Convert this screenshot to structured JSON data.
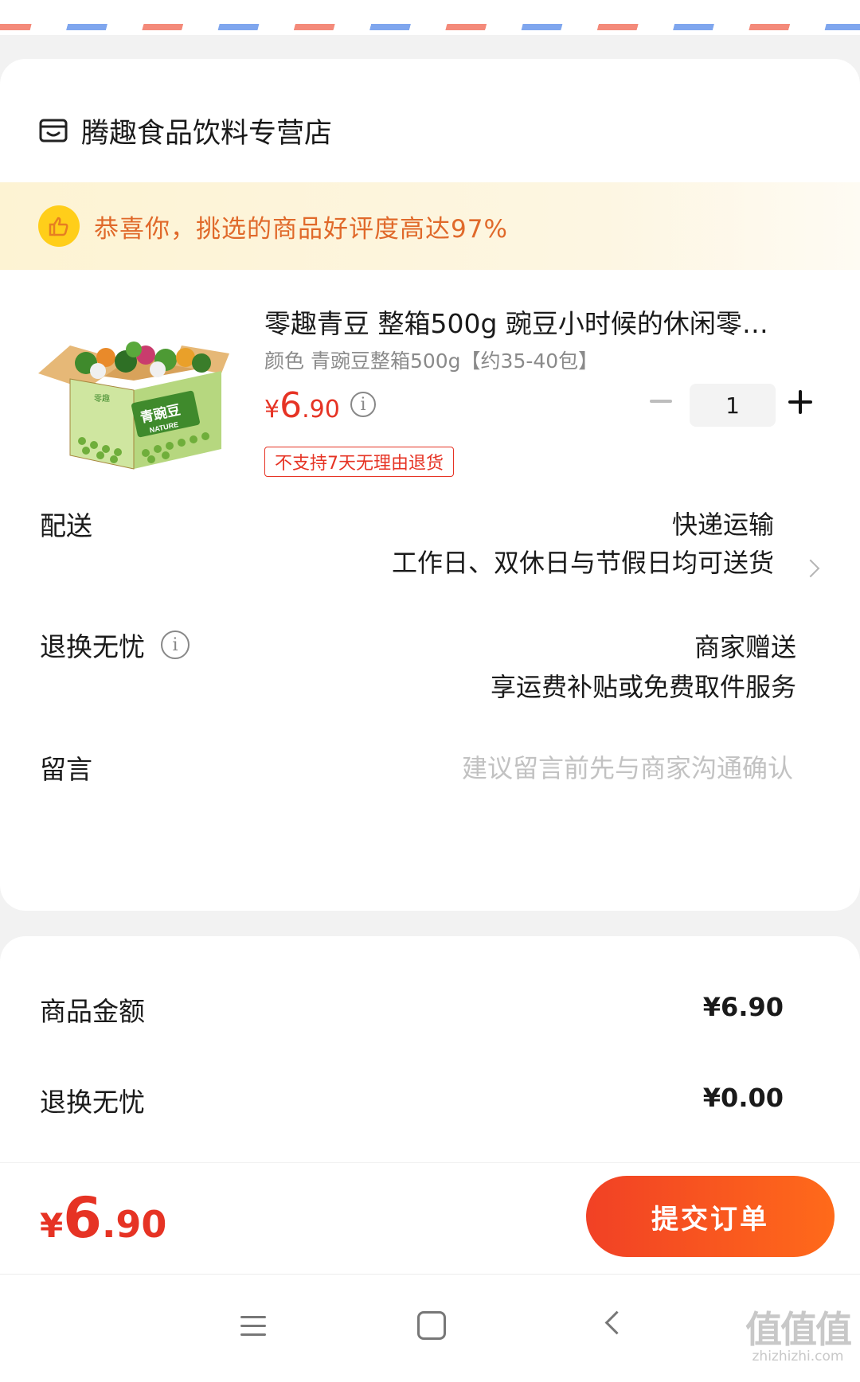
{
  "store": {
    "name": "腾趣食品饮料专营店"
  },
  "banner": {
    "text": "恭喜你，挑选的商品好评度高达97%"
  },
  "product": {
    "title": "零趣青豆 整箱500g 豌豆小时候的休闲零…",
    "spec": "颜色 青豌豆整箱500g【约35-40包】",
    "price_symbol": "¥",
    "price_int": "6",
    "price_dec": ".90",
    "quantity": "1",
    "return_tag": "不支持7天无理由退货",
    "box_brand": "零趣",
    "box_title": "青豌豆",
    "box_sub": "NATURE"
  },
  "delivery": {
    "label": "配送",
    "method": "快递运输",
    "note": "工作日、双休日与节假日均可送货"
  },
  "worry_free": {
    "label": "退换无忧",
    "value": "商家赠送",
    "note": "享运费补贴或免费取件服务"
  },
  "message": {
    "label": "留言",
    "placeholder": "建议留言前先与商家沟通确认"
  },
  "summary": {
    "goods_label": "商品金额",
    "goods_value": "¥6.90",
    "worry_label": "退换无忧",
    "worry_value": "¥0.00"
  },
  "checkout": {
    "total_symbol": "¥",
    "total_int": "6",
    "total_dec": ".90",
    "submit_label": "提交订单"
  },
  "watermark": {
    "big": "值值值",
    "small": "zhizhizhi.com"
  },
  "colors": {
    "accent": "#e63324",
    "banner_text": "#e0692a",
    "button_start": "#f14125",
    "button_end": "#ff6a1a"
  }
}
